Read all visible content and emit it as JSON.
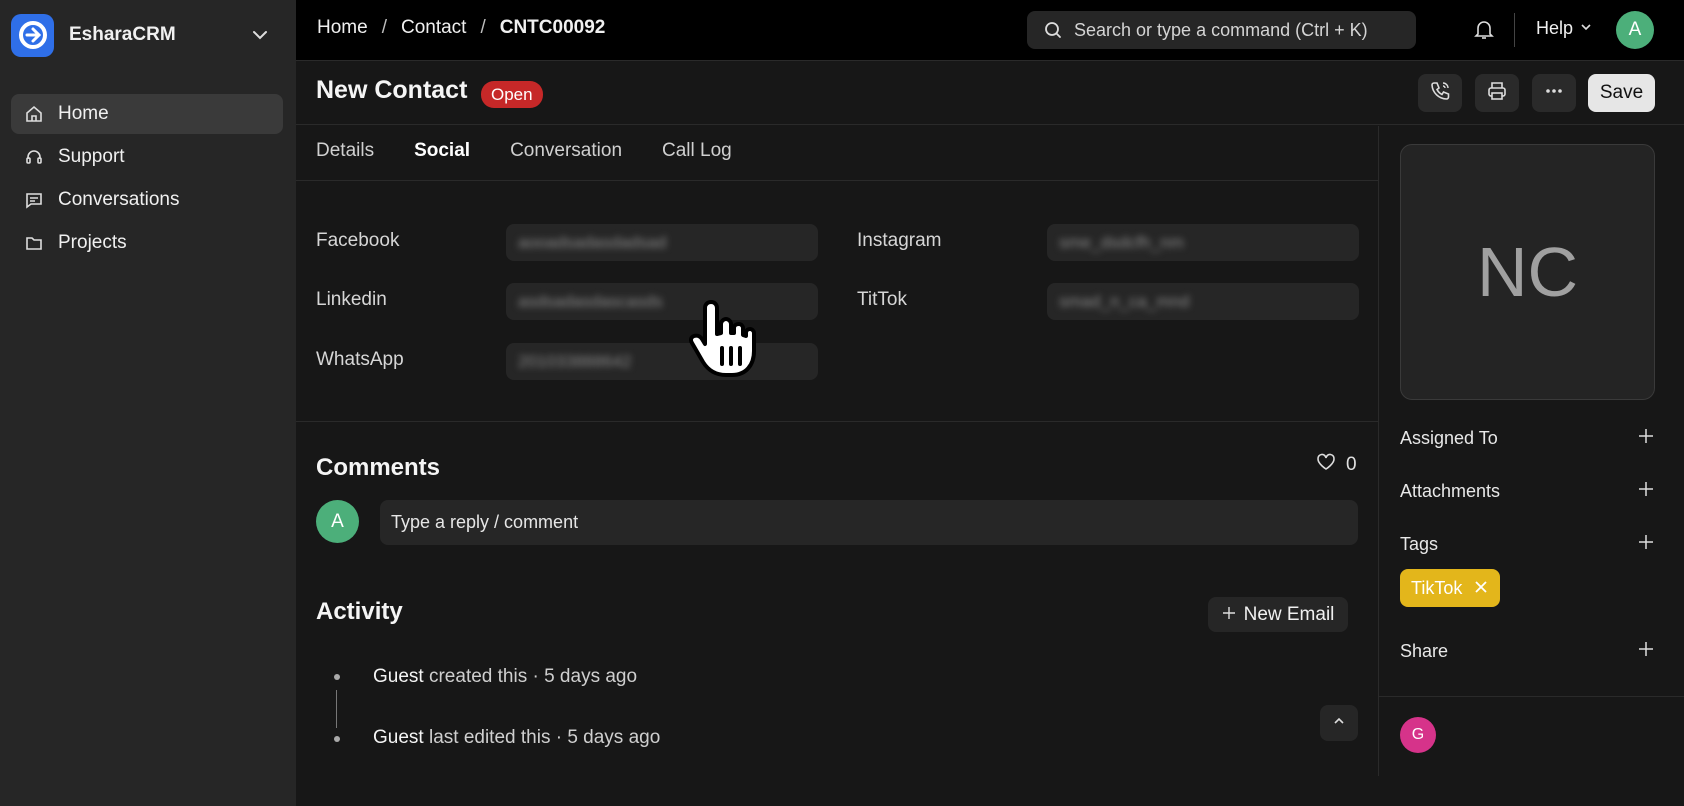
{
  "app": {
    "name": "EsharaCRM"
  },
  "sidebar": {
    "items": [
      {
        "label": "Home",
        "icon": "home-icon"
      },
      {
        "label": "Support",
        "icon": "headset-icon"
      },
      {
        "label": "Conversations",
        "icon": "chat-icon"
      },
      {
        "label": "Projects",
        "icon": "folder-icon"
      }
    ]
  },
  "breadcrumb": {
    "items": [
      "Home",
      "Contact",
      "CNTC00092"
    ],
    "separator": "/"
  },
  "search": {
    "placeholder": "Search or type a command (Ctrl + K)"
  },
  "topbar": {
    "help_label": "Help",
    "avatar_initial": "A"
  },
  "header": {
    "title": "New Contact",
    "status": "Open",
    "save_label": "Save"
  },
  "tabs": [
    "Details",
    "Social",
    "Conversation",
    "Call Log"
  ],
  "social": {
    "facebook": {
      "label": "Facebook",
      "value": "aooadsadasdadsad"
    },
    "instagram": {
      "label": "Instagram",
      "value": "sme_dsdcfh_nm"
    },
    "linkedin": {
      "label": "Linkedin",
      "value": "asdsadasdascasds"
    },
    "tiktok": {
      "label": "TitTok",
      "value": "smad_n_ca_mnd"
    },
    "whatsapp": {
      "label": "WhatsApp",
      "value": "201033888642"
    }
  },
  "comments": {
    "title": "Comments",
    "likes": "0",
    "avatar_initial": "A",
    "placeholder": "Type a reply / comment"
  },
  "activity": {
    "title": "Activity",
    "new_email_label": "New Email",
    "items": [
      {
        "actor": "Guest",
        "text": " created this · 5 days ago"
      },
      {
        "actor": "Guest",
        "text": " last edited this · 5 days ago"
      }
    ]
  },
  "right_panel": {
    "avatar_initials": "NC",
    "assigned_to": "Assigned To",
    "attachments": "Attachments",
    "tags_label": "Tags",
    "tag": "TikTok",
    "share": "Share",
    "viewer_initial": "G"
  },
  "colors": {
    "accent_blue": "#2f6fe8",
    "status_red": "#c62828",
    "tag_yellow": "#e3b61b",
    "avatar_green": "#4caf7a",
    "viewer_pink": "#d6338a"
  }
}
